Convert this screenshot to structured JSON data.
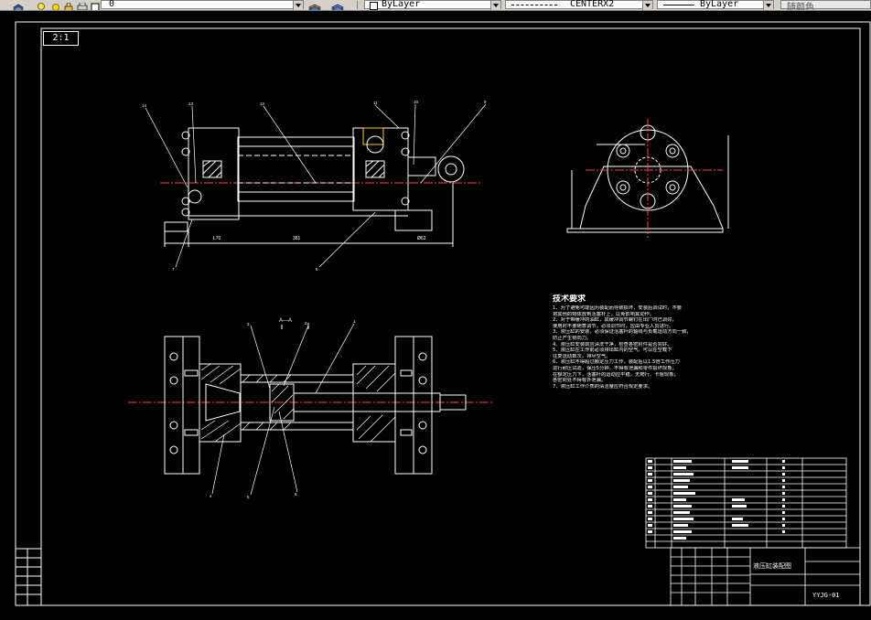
{
  "toolbar": {
    "layer_value": "0",
    "color_value": "ByLayer",
    "linetype_value": "CENTERX2",
    "lineweight_value": "ByLayer",
    "plotstyle_value": "随颜色"
  },
  "drawing": {
    "scale": "2:1",
    "section_label": "A—A",
    "dim_top_left": "L70",
    "dim_top_middle": "381",
    "dim_top_right": "Ø63",
    "part_callouts_top": [
      "14",
      "13",
      "12",
      "11",
      "10",
      "9",
      "7",
      "8"
    ],
    "part_callouts_bottom": [
      "3",
      "2",
      "1",
      "4",
      "5",
      "6"
    ],
    "tech_requirements": {
      "title": "技术要求",
      "lines": [
        "1、为了避免可能因为装配而导致损坏，安装后调试时，不要",
        "   将其他的物体放到活塞杆上，以免影响其动作。",
        "2、对于带缓冲的油缸，其缓冲调节螺钉在出厂时已调好，",
        "   使用时不要随意调节，必须调节时，应由专业人员进行。",
        "3、液压缸的安装，必须保证活塞杆的轴线与负载运动方向一致，",
        "   防止产生侧向力。",
        "4、液压缸安装前应清洗干净，检查各密封件是否完好。",
        "5、液压缸在工作前必须排出缸内的空气，可以在空载下",
        "   往复运动数次，排尽空气。",
        "6、液压缸不得超过额定压力工作，装配后以1.5倍工作压力",
        "   进行耐压试验，保压5分钟，不得有泄漏和零件损坏现象；",
        "   在额定压力下，活塞杆的运动应平稳，无爬行、卡阻现象；",
        "   各密封处不得有外泄漏。",
        "7、液压缸工作介质的清洁度应符合规定要求。"
      ]
    },
    "title_block": {
      "title": "液压缸装配图",
      "code": "YYJG-01"
    }
  }
}
